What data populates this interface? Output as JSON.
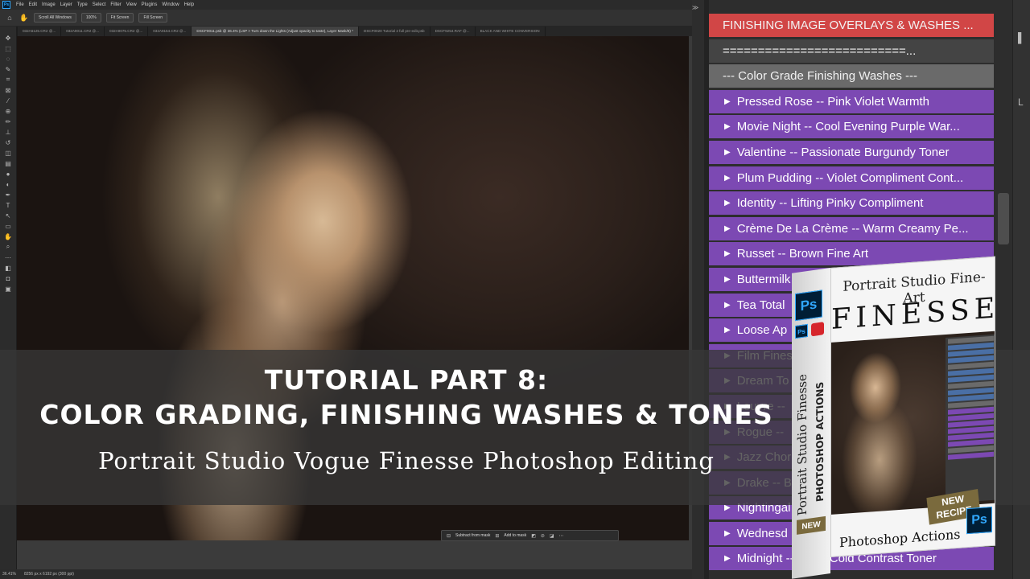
{
  "menubar": {
    "items": [
      "File",
      "Edit",
      "Image",
      "Layer",
      "Type",
      "Select",
      "Filter",
      "View",
      "Plugins",
      "Window",
      "Help"
    ]
  },
  "options": {
    "scroll_all": "Scroll All Windows",
    "zoom": "100%",
    "fit": "Fit Screen",
    "fill": "Fill Screen"
  },
  "tabs": [
    "032A6125.CR2 @...",
    "032A9011.CR2 @...",
    "032A9075.CR2 @...",
    "032A9154.CR2 @...",
    "DSCF0011.psb @ 36.4% (LSP > Turn down the Lights (Adjust opacity to taste), Layer Mask/8) *",
    "DSCF0020 Tutorial 2 full pre-edit.psb",
    "DSCF9254.RAF @...",
    "BLACK AND WHITE CONVERSION"
  ],
  "status": {
    "zoom": "36.41%",
    "doc": "8256 px x 6192 px (300 ppi)"
  },
  "maskbar": {
    "subtract": "Subtract from mask",
    "add": "Add to mask"
  },
  "actions": [
    {
      "text": "FINISHING IMAGE OVERLAYS & WASHES  ...",
      "kind": "red"
    },
    {
      "text": "==========================...",
      "kind": "sep"
    },
    {
      "text": "--- Color Grade Finishing Washes ---",
      "kind": "grey"
    },
    {
      "text": "Pressed Rose -- Pink Violet Warmth",
      "kind": "purple"
    },
    {
      "text": "Movie Night -- Cool Evening Purple War...",
      "kind": "purple"
    },
    {
      "text": "Valentine -- Passionate Burgundy Toner",
      "kind": "purple"
    },
    {
      "text": "Plum Pudding -- Violet Compliment Cont...",
      "kind": "purple"
    },
    {
      "text": "Identity -- Lifting Pinky Compliment",
      "kind": "purple"
    },
    {
      "text": "Crème De La Crème -- Warm Creamy Pe...",
      "kind": "purple"
    },
    {
      "text": "Russet -- Brown Fine Art",
      "kind": "purple"
    },
    {
      "text": "Buttermilk",
      "kind": "purple"
    },
    {
      "text": "Tea Total",
      "kind": "purple"
    },
    {
      "text": "Loose Ap",
      "kind": "purple"
    },
    {
      "text": "Film Fines",
      "kind": "purple"
    },
    {
      "text": "Dream To",
      "kind": "purple"
    },
    {
      "text": "Louvre --",
      "kind": "purple"
    },
    {
      "text": "Rogue --",
      "kind": "purple"
    },
    {
      "text": "Jazz Chor",
      "kind": "purple"
    },
    {
      "text": "Drake -- B",
      "kind": "purple"
    },
    {
      "text": "Nightingal",
      "kind": "purple"
    },
    {
      "text": "Wednesd",
      "kind": "purple"
    },
    {
      "text": "Midnight -- Deep Cold Contrast Toner",
      "kind": "purple"
    }
  ],
  "overlay": {
    "line1": "TUTORIAL PART 8:",
    "line2": "COLOR GRADING, FINISHING WASHES & TONES",
    "subtitle": "Portrait Studio Vogue Finesse Photoshop Editing"
  },
  "product": {
    "script_title": "Portrait Studio Fine-Art",
    "big_title": "FINESSE",
    "side_title": "Portrait Studio Finesse",
    "side_sub": "PHOTOSHOP ACTIONS",
    "side_new": "NEW",
    "badge": "NEW RECIPE",
    "footer": "Photoshop Actions",
    "ps": "Ps"
  }
}
